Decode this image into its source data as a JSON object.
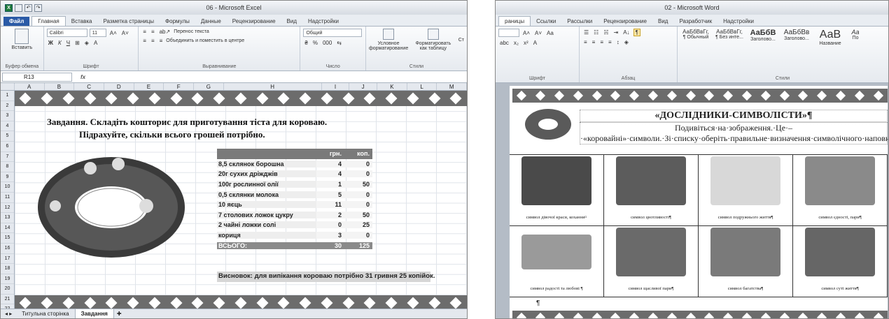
{
  "excel": {
    "title": "06 - Microsoft Excel",
    "tabs": [
      "Файл",
      "Главная",
      "Вставка",
      "Разметка страницы",
      "Формулы",
      "Данные",
      "Рецензирование",
      "Вид",
      "Надстройки"
    ],
    "clipboard": {
      "paste": "Вставить",
      "group": "Буфер обмена"
    },
    "font": {
      "name": "Calibri",
      "size": "11",
      "group": "Шрифт",
      "bold": "Ж",
      "italic": "К",
      "underline": "Ч"
    },
    "alignment": {
      "wrap": "Перенос текста",
      "merge": "Объединить и поместить в центре",
      "group": "Выравнивание"
    },
    "number": {
      "format": "Общий",
      "group": "Число",
      "percent": "%",
      "thousands": "000"
    },
    "styles": {
      "conditional": "Условное форматирование",
      "as_table": "Форматировать как таблицу",
      "group": "Стили",
      "cut": "Ст"
    },
    "name_box": "R13",
    "fx": "fx",
    "columns": [
      "A",
      "B",
      "C",
      "D",
      "E",
      "F",
      "G",
      "H",
      "I",
      "J",
      "K",
      "L",
      "M"
    ],
    "rows": [
      "1",
      "2",
      "3",
      "4",
      "5",
      "6",
      "7",
      "8",
      "9",
      "10",
      "11",
      "12",
      "13",
      "14",
      "15",
      "16",
      "17",
      "18",
      "19",
      "20",
      "21",
      "22"
    ],
    "task_line1": "Завдання. Складіть кошторис для приготування тіста для короваю.",
    "task_line2": "Підрахуйте, скільки всього грошей потрібно.",
    "table_header": {
      "name": "",
      "uah": "грн.",
      "kop": "коп."
    },
    "items": [
      {
        "name": "8,5 склянок борошна",
        "uah": "4",
        "kop": "0"
      },
      {
        "name": "20г сухих дріжджів",
        "uah": "4",
        "kop": "0"
      },
      {
        "name": "100г рослинної олії",
        "uah": "1",
        "kop": "50"
      },
      {
        "name": "0,5 склянки молока",
        "uah": "5",
        "kop": "0"
      },
      {
        "name": "10 яєць",
        "uah": "11",
        "kop": "0"
      },
      {
        "name": "7 столових ложок цукру",
        "uah": "2",
        "kop": "50"
      },
      {
        "name": "2 чайні ложки солі",
        "uah": "0",
        "kop": "25"
      },
      {
        "name": "кориця",
        "uah": "3",
        "kop": "0"
      }
    ],
    "total": {
      "name": "ВСЬОГО:",
      "uah": "30",
      "kop": "125"
    },
    "conclusion": "Висновок: для випікання короваю потрібно 31 гривня 25 копійок.",
    "sheet_tabs": [
      "Титульна сторінка",
      "Завдання"
    ]
  },
  "word": {
    "title": "02 - Microsoft Word",
    "tabs": [
      "раницы",
      "Ссылки",
      "Рассылки",
      "Рецензирование",
      "Вид",
      "Разработчик",
      "Надстройки"
    ],
    "groups": {
      "font": "Шрифт",
      "paragraph": "Абзац",
      "styles": "Стили"
    },
    "styles": [
      {
        "sample": "АаБбВвГг,",
        "name": "¶ Обычный"
      },
      {
        "sample": "АаБбВвГг,",
        "name": "¶ Без инте..."
      },
      {
        "sample": "АаБбВ",
        "name": "Заголово..."
      },
      {
        "sample": "АаБбВв",
        "name": "Заголово..."
      },
      {
        "sample": "АаВ",
        "name": "Название"
      },
      {
        "sample": "Аа",
        "name": "По"
      }
    ],
    "doc_title": "«ДОСЛІДНИКИ-СИМВОЛІСТИ»¶",
    "doc_sub": "Подивіться·на·зображення.·Це·–·«коровайні»·символи.·Зі·списку·оберіть·правильне·визначення·символічного·наповнення·даних·предметів.¶",
    "captions": [
      "символ дівочої краси, кохання¤",
      "символ цнотливості¶",
      "символ подружнього життя¶",
      "символ єдності, пари¶",
      "символ радості та любові ¶",
      "символ щасливої пари¶",
      "символ багатства¶",
      "символ суті життя¶"
    ],
    "para_mark": "¶"
  },
  "colors": {
    "strip": "#6c6c6c",
    "header_gray": "#7a7a7a",
    "file_tab": "#2a5aa6"
  }
}
